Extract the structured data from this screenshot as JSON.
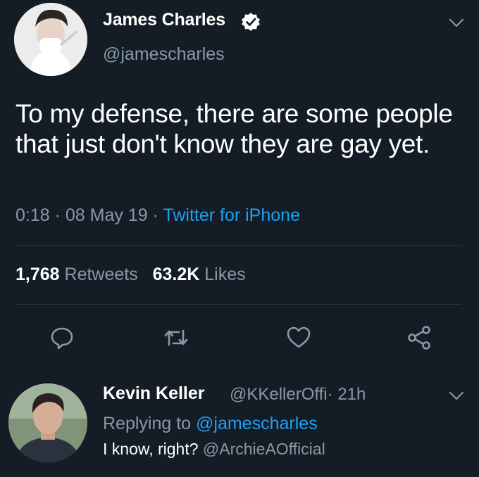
{
  "tweet": {
    "author_name": "James Charles",
    "handle": "@jamescharles",
    "verified_icon": "verified-badge-icon",
    "text": "To my defense, there are some people that just don't know they are gay yet.",
    "time": "0:18",
    "date": "08 May 19",
    "separator": "·",
    "source": "Twitter for iPhone",
    "retweets_count": "1,768",
    "retweets_label": "Retweets",
    "likes_count": "63.2K",
    "likes_label": "Likes",
    "actions": [
      "reply-icon",
      "retweet-icon",
      "like-icon",
      "share-icon"
    ]
  },
  "reply": {
    "author_name": "Kevin Keller",
    "handle": "@KKellerOffi",
    "separator": "·",
    "time": "21h",
    "replying_to_label": "Replying to",
    "replying_to_handle": "@jamescharles",
    "text": "I know, right?",
    "mention": "@ArchieAOfficial"
  },
  "colors": {
    "background": "#141d26",
    "secondary_text": "#8899a6",
    "accent": "#1da1f2",
    "divider": "#2b3945"
  }
}
